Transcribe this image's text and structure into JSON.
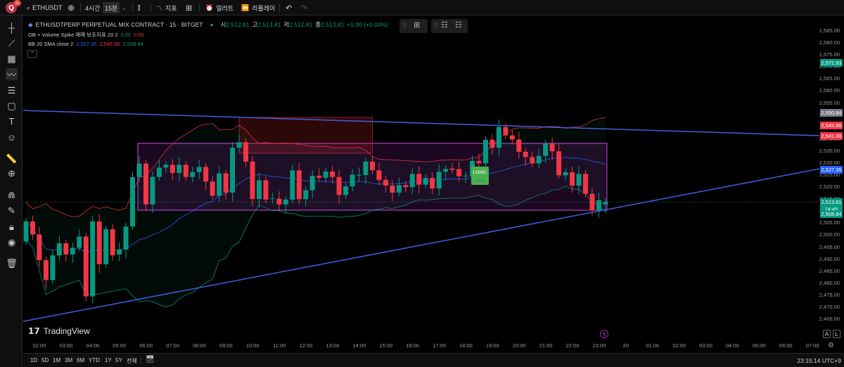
{
  "topbar": {
    "avatar_letter": "Q",
    "notification_count": "11",
    "symbol": "ETHUSDT",
    "interval_4h": "4시간",
    "interval_15m": "15분",
    "indicators_label": "지표",
    "alert_label": "얼러트",
    "replay_label": "리플레이"
  },
  "legend": {
    "title": "ETHUSDTPERP PERPETUAL MIX CONTRACT · 15 · BITGET",
    "o_label": "시",
    "o": "2,512.81",
    "h_label": "고",
    "h": "2,513.81",
    "l_label": "저",
    "l": "2,512.81",
    "c_label": "종",
    "c": "2,513.81",
    "change": "+1.00 (+0.04%)",
    "ind1_name": "OB + Volume Spike 매매 보조지표 20 2",
    "ind1_v1": "0.00",
    "ind1_v2": "0.00",
    "ind2_name": "BB 20 SMA close 2",
    "ind2_basis": "2,527.35",
    "ind2_upper": "2,545.86",
    "ind2_lower": "2,508.84"
  },
  "price_axis": [
    "2,585.00",
    "2,580.00",
    "2,575.00",
    "2,570.00",
    "2,565.00",
    "2,560.00",
    "2,555.00",
    "2,550.00",
    "2,545.00",
    "2,540.00",
    "2,535.00",
    "2,530.00",
    "2,525.00",
    "2,520.00",
    "2,515.00",
    "2,510.00",
    "2,505.00",
    "2,500.00",
    "2,495.00",
    "2,490.00",
    "2,485.00",
    "2,480.00",
    "2,475.00",
    "2,470.00",
    "2,465.00"
  ],
  "price_labels": [
    {
      "value": "2,571.93",
      "color": "#089981"
    },
    {
      "value": "2,550.94",
      "color": "#787b86"
    },
    {
      "value": "2,545.86",
      "color": "#f23645"
    },
    {
      "value": "2,541.38",
      "color": "#f23645"
    },
    {
      "value": "2,527.35",
      "color": "#2962ff"
    },
    {
      "value": "2,513.81",
      "color": "#089981",
      "sub": "14:45"
    },
    {
      "value": "2,508.84",
      "color": "#089981"
    }
  ],
  "time_axis": [
    "02:00",
    "03:00",
    "04:00",
    "05:00",
    "06:00",
    "07:00",
    "08:00",
    "09:00",
    "10:00",
    "11:00",
    "12:00",
    "13:00",
    "14:00",
    "15:00",
    "16:00",
    "17:00",
    "18:00",
    "19:00",
    "20:00",
    "21:00",
    "22:00",
    "23:00",
    "20",
    "01:00",
    "02:00",
    "03:00",
    "04:00",
    "05:00",
    "06:00",
    "07:00"
  ],
  "ranges": [
    "1D",
    "5D",
    "1M",
    "3M",
    "6M",
    "YTD",
    "1Y",
    "5Y",
    "전체"
  ],
  "clock": "23:15:14 UTC+9",
  "logo_text": "TradingView",
  "scale_buttons": [
    "A",
    "L"
  ],
  "signal_label": "LONG",
  "colors": {
    "up": "#089981",
    "down": "#f23645",
    "bb_basis": "#2962ff",
    "bb_upper": "#f23645",
    "bb_lower": "#089981",
    "trendline": "#3f5fe0",
    "box": "#b23fc6"
  },
  "chart_data": {
    "type": "candlestick",
    "first_time": "01:30",
    "interval": "15m",
    "ylim": [
      2462,
      2588
    ],
    "ohlc_open_close": [
      [
        2497.4,
        2505.7
      ],
      [
        2505.7,
        2500.3
      ],
      [
        2500.3,
        2489.6
      ],
      [
        2489.6,
        2481.3
      ],
      [
        2481.3,
        2491.6
      ],
      [
        2491.6,
        2496.6
      ],
      [
        2496.6,
        2492.0
      ],
      [
        2492.0,
        2494.7
      ],
      [
        2494.7,
        2499.4
      ],
      [
        2499.4,
        2474.5
      ],
      [
        2474.5,
        2505.7
      ],
      [
        2505.7,
        2487.9
      ],
      [
        2487.9,
        2502.5
      ],
      [
        2502.5,
        2491.6
      ],
      [
        2492.0,
        2494.0
      ],
      [
        2494.0,
        2503.6
      ],
      [
        2503.6,
        2524.2
      ],
      [
        2524.2,
        2529.8
      ],
      [
        2529.8,
        2512.8
      ],
      [
        2512.8,
        2524.2
      ],
      [
        2524.2,
        2528.1
      ],
      [
        2528.1,
        2529.3
      ],
      [
        2529.3,
        2525.9
      ],
      [
        2525.9,
        2529.3
      ],
      [
        2529.3,
        2524.2
      ],
      [
        2524.2,
        2526.2
      ],
      [
        2526.2,
        2528.4
      ],
      [
        2528.4,
        2522.3
      ],
      [
        2522.3,
        2516.4
      ],
      [
        2516.4,
        2525.7
      ],
      [
        2525.7,
        2517.7
      ],
      [
        2517.7,
        2536.4
      ],
      [
        2536.4,
        2538.7
      ],
      [
        2538.7,
        2530.6
      ],
      [
        2530.6,
        2515.0
      ],
      [
        2515.0,
        2522.8
      ],
      [
        2522.8,
        2514.8
      ],
      [
        2515.2,
        2515.4
      ],
      [
        2515.2,
        2512.8
      ],
      [
        2512.8,
        2514.8
      ],
      [
        2514.8,
        2527.0
      ],
      [
        2527.0,
        2515.0
      ],
      [
        2515.0,
        2518.7
      ],
      [
        2518.7,
        2524.7
      ],
      [
        2524.7,
        2523.9
      ],
      [
        2523.9,
        2526.5
      ],
      [
        2526.5,
        2524.2
      ],
      [
        2524.2,
        2516.7
      ],
      [
        2516.7,
        2520.3
      ],
      [
        2520.3,
        2525.2
      ],
      [
        2525.0,
        2525.1
      ],
      [
        2525.0,
        2530.6
      ],
      [
        2530.6,
        2527.0
      ],
      [
        2527.0,
        2523.0
      ],
      [
        2523.0,
        2520.6
      ],
      [
        2520.6,
        2517.7
      ],
      [
        2517.7,
        2520.8
      ],
      [
        2520.8,
        2520.0
      ],
      [
        2520.0,
        2525.5
      ],
      [
        2525.5,
        2521.0
      ],
      [
        2521.0,
        2523.8
      ],
      [
        2523.8,
        2519.4
      ],
      [
        2519.4,
        2526.4
      ],
      [
        2526.4,
        2527.5
      ],
      [
        2527.7,
        2527.2
      ],
      [
        2527.5,
        2524.5
      ],
      [
        2524.7,
        2524.8
      ],
      [
        2524.5,
        2530.9
      ],
      [
        2530.9,
        2529.9
      ],
      [
        2529.9,
        2539.7
      ],
      [
        2539.7,
        2536.4
      ],
      [
        2536.4,
        2545.0
      ],
      [
        2545.0,
        2541.5
      ],
      [
        2541.5,
        2539.8
      ],
      [
        2539.8,
        2534.7
      ],
      [
        2534.7,
        2532.5
      ],
      [
        2532.5,
        2529.9
      ],
      [
        2529.9,
        2533.0
      ],
      [
        2533.0,
        2538.1
      ],
      [
        2538.1,
        2534.9
      ],
      [
        2534.9,
        2524.9
      ],
      [
        2524.9,
        2526.2
      ],
      [
        2526.2,
        2520.6
      ],
      [
        2520.6,
        2525.5
      ],
      [
        2525.5,
        2517.2
      ],
      [
        2517.2,
        2510.3
      ],
      [
        2510.3,
        2514.5
      ],
      [
        2512.81,
        2513.81
      ]
    ],
    "trendlines": [
      {
        "start_price": 2551.9,
        "end_price": 2541.4
      },
      {
        "start_price": 2464.1,
        "end_price": 2527.6
      }
    ],
    "zones": [
      {
        "kind": "range-box",
        "from": "05:45",
        "to": "23:15",
        "top": 2538.2,
        "bottom": 2510.4
      },
      {
        "kind": "order-block",
        "from": "09:30",
        "to": "14:30",
        "top": 2549.0,
        "bottom": 2534.1
      }
    ],
    "signals": [
      {
        "time": "18:30",
        "label": "LONG"
      }
    ]
  }
}
